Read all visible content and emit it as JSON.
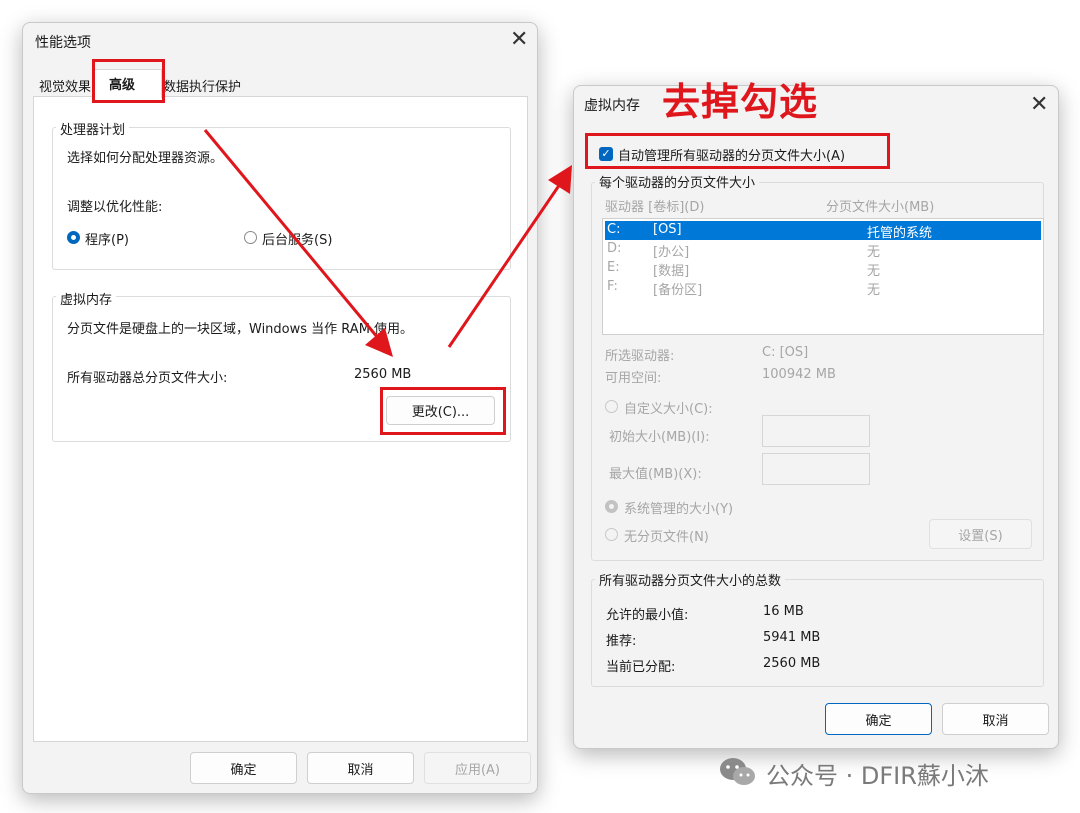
{
  "annotation_text": "去掉勾选",
  "watermark": "公众号 · DFIR蘇小沐",
  "colors": {
    "accent": "#0067c0",
    "annotation_red": "#e0161d",
    "selection": "#0078d7"
  },
  "perf_dialog": {
    "title": "性能选项",
    "tabs": [
      "视觉效果",
      "高级",
      "数据执行保护"
    ],
    "processor": {
      "legend": "处理器计划",
      "desc": "选择如何分配处理器资源。",
      "adjust_label": "调整以优化性能:",
      "options": [
        "程序(P)",
        "后台服务(S)"
      ],
      "selected": "程序(P)"
    },
    "virtual_memory": {
      "legend": "虚拟内存",
      "desc": "分页文件是硬盘上的一块区域，Windows 当作 RAM 使用。",
      "total_label": "所有驱动器总分页文件大小:",
      "total_value": "2560 MB",
      "change_button": "更改(C)..."
    },
    "buttons": {
      "ok": "确定",
      "cancel": "取消",
      "apply": "应用(A)"
    }
  },
  "vm_dialog": {
    "title": "虚拟内存",
    "auto_manage": {
      "label": "自动管理所有驱动器的分页文件大小(A)",
      "checked": true
    },
    "per_drive": {
      "legend": "每个驱动器的分页文件大小",
      "headers": [
        "驱动器 [卷标](D)",
        "分页文件大小(MB)"
      ],
      "drives": [
        {
          "letter": "C:",
          "label": "[OS]",
          "size": "托管的系统",
          "selected": true
        },
        {
          "letter": "D:",
          "label": "[办公]",
          "size": "无"
        },
        {
          "letter": "E:",
          "label": "[数据]",
          "size": "无"
        },
        {
          "letter": "F:",
          "label": "[备份区]",
          "size": "无"
        }
      ],
      "selected_drive_label": "所选驱动器:",
      "selected_drive_value": "C:  [OS]",
      "free_space_label": "可用空间:",
      "free_space_value": "100942 MB",
      "custom_size": "自定义大小(C):",
      "initial_size": "初始大小(MB)(I):",
      "max_size": "最大值(MB)(X):",
      "system_managed": "系统管理的大小(Y)",
      "no_paging": "无分页文件(N)",
      "set_button": "设置(S)"
    },
    "totals": {
      "legend": "所有驱动器分页文件大小的总数",
      "min_label": "允许的最小值:",
      "min_value": "16 MB",
      "rec_label": "推荐:",
      "rec_value": "5941 MB",
      "cur_label": "当前已分配:",
      "cur_value": "2560 MB"
    },
    "buttons": {
      "ok": "确定",
      "cancel": "取消"
    }
  }
}
